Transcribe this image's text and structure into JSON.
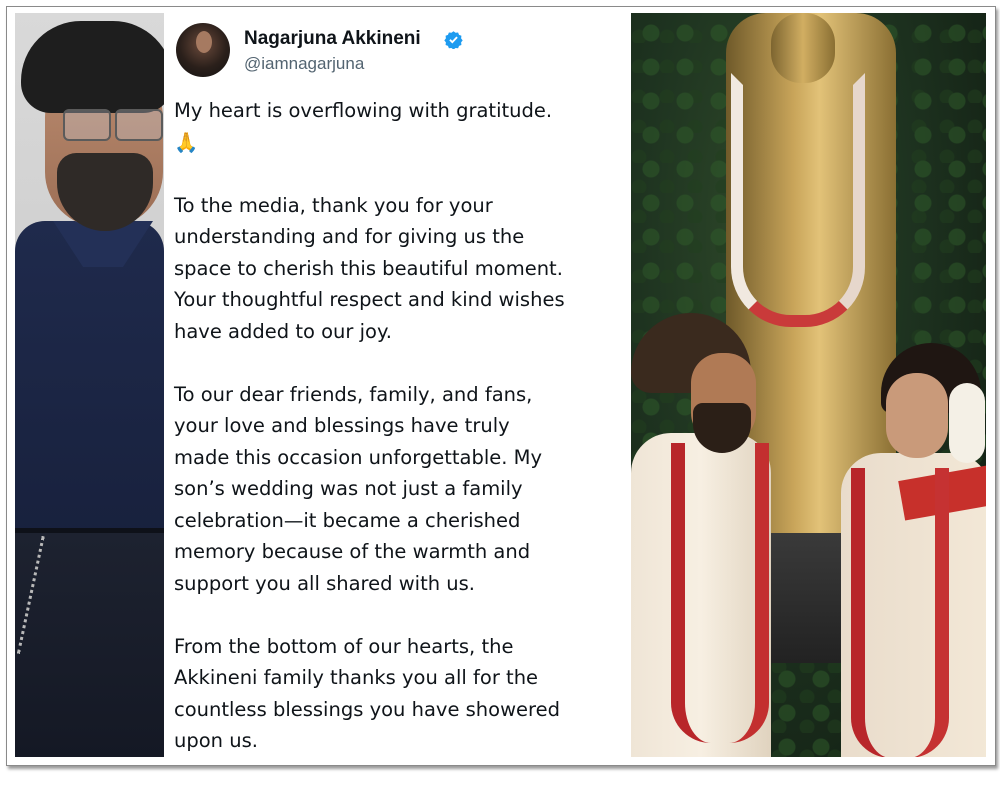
{
  "tweet": {
    "author_name": "Nagarjuna Akkineni",
    "handle": "@iamnagarjuna",
    "paragraphs": [
      "My heart is overflowing with gratitude.\n🙏",
      "To the media, thank you for your\nunderstanding and for giving us the\nspace to cherish this beautiful moment.\nYour thoughtful respect and kind wishes\nhave added to our joy.",
      "To our dear friends, family, and fans,\nyour love and blessings have truly\nmade this occasion unforgettable. My\nson’s wedding was not just a family\ncelebration—it became a cherished\nmemory because of the warmth and\nsupport you all shared with us.",
      "From the bottom of our hearts, the\nAkkineni family thanks you all for the\ncountless blessings you have showered\nupon us."
    ]
  },
  "icons": {
    "verified": "verified-badge-icon",
    "verified_color": "#1d9bf0"
  }
}
